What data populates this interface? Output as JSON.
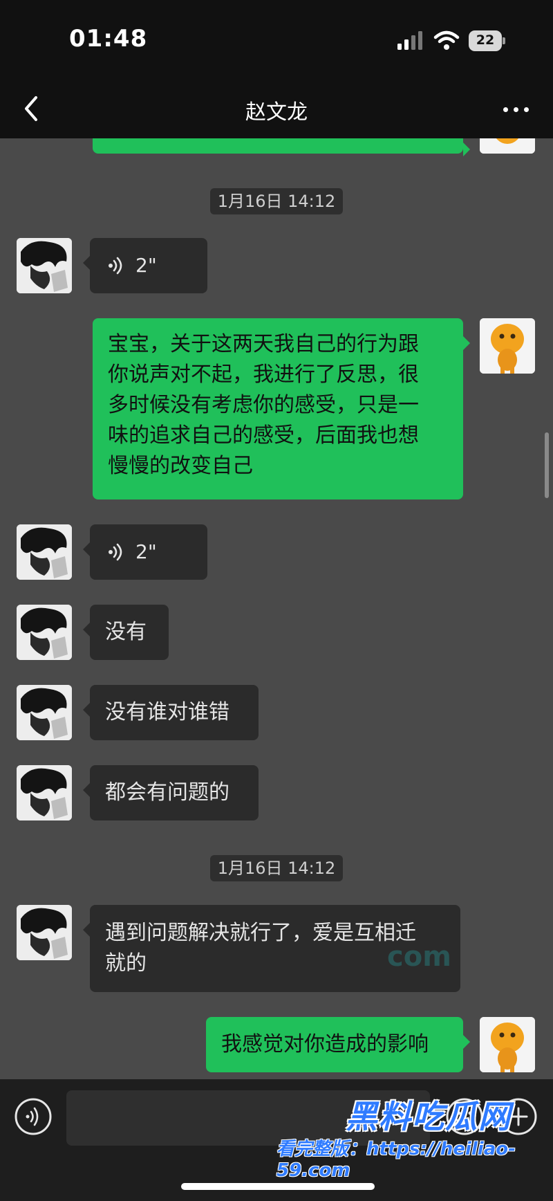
{
  "status_bar": {
    "time": "01:48",
    "battery": "22",
    "signal_icon": "signal-bars-icon",
    "wifi_icon": "wifi-icon"
  },
  "nav": {
    "title": "赵文龙",
    "back_icon": "chevron-left-icon",
    "more_icon": "more-dots-icon"
  },
  "timestamps": [
    "1月16日 14:12",
    "1月16日 14:12"
  ],
  "messages": [
    {
      "from": "self",
      "type": "text",
      "text": ""
    },
    {
      "from": "other",
      "type": "voice",
      "duration": "2\""
    },
    {
      "from": "self",
      "type": "text",
      "lines": [
        "宝宝，关于这两天我自己的行为跟",
        "你说声对不起，我进行了反思，很",
        "多时候没有考虑你的感受，只是一",
        "味的追求自己的感受，后面我也想",
        "慢慢的改变自己"
      ]
    },
    {
      "from": "other",
      "type": "voice",
      "duration": "2\""
    },
    {
      "from": "other",
      "type": "text",
      "text": "没有"
    },
    {
      "from": "other",
      "type": "text",
      "text": "没有谁对谁错"
    },
    {
      "from": "other",
      "type": "text",
      "text": "都会有问题的"
    },
    {
      "from": "other",
      "type": "text",
      "lines": [
        "遇到问题解决就行了，爱是互相迁",
        "就的"
      ]
    },
    {
      "from": "self",
      "type": "text",
      "text": "我感觉对你造成的影响"
    }
  ],
  "watermark": {
    "overlay": "com",
    "site_name": "黑料吃瓜网",
    "site_url": "看完整版：https://heiliao-59.com"
  },
  "input_bar": {
    "placeholder": "",
    "voice_icon": "voice-toggle-icon",
    "emoji_icon": "emoji-icon",
    "plus_icon": "plus-icon"
  },
  "colors": {
    "chat_bg": "#4a4a4a",
    "sent_bubble": "#20c05a",
    "recv_bubble": "#2b2b2b",
    "bars": "#111111"
  }
}
